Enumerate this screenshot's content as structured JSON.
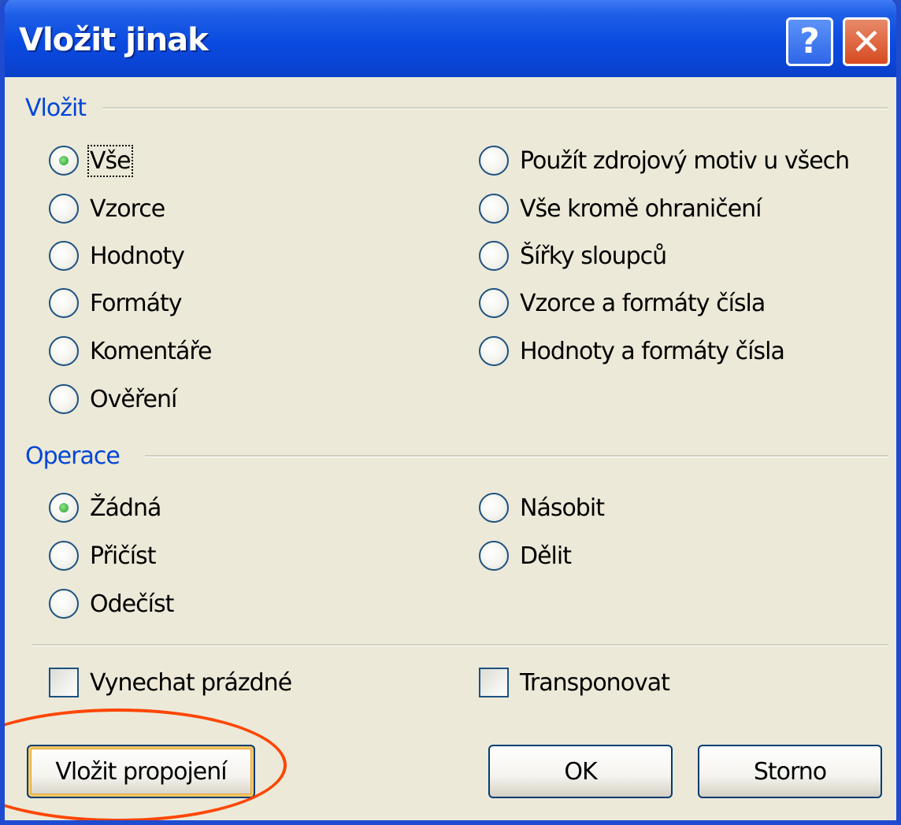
{
  "window": {
    "title": "Vložit jinak",
    "help_button_label": "?",
    "close_button_label": "✕"
  },
  "paste_group": {
    "label": "Vložit",
    "options_left": [
      {
        "label": "Vše",
        "checked": true
      },
      {
        "label": "Vzorce",
        "checked": false
      },
      {
        "label": "Hodnoty",
        "checked": false
      },
      {
        "label": "Formáty",
        "checked": false
      },
      {
        "label": "Komentáře",
        "checked": false
      },
      {
        "label": "Ověření",
        "checked": false
      }
    ],
    "options_right": [
      {
        "label": "Použít zdrojový motiv u všech",
        "checked": false
      },
      {
        "label": "Vše kromě ohraničení",
        "checked": false
      },
      {
        "label": "Šířky sloupců",
        "checked": false
      },
      {
        "label": "Vzorce a formáty čísla",
        "checked": false
      },
      {
        "label": "Hodnoty a formáty čísla",
        "checked": false
      }
    ]
  },
  "operation_group": {
    "label": "Operace",
    "options_left": [
      {
        "label": "Žádná",
        "checked": true
      },
      {
        "label": "Přičíst",
        "checked": false
      },
      {
        "label": "Odečíst",
        "checked": false
      }
    ],
    "options_right": [
      {
        "label": "Násobit",
        "checked": false
      },
      {
        "label": "Dělit",
        "checked": false
      }
    ]
  },
  "checkboxes": {
    "skip_blanks": {
      "label": "Vynechat prázdné",
      "checked": false
    },
    "transpose": {
      "label": "Transponovat",
      "checked": false
    }
  },
  "buttons": {
    "paste_link": "Vložit propojení",
    "ok": "OK",
    "cancel": "Storno"
  },
  "colors": {
    "title_bar": "#0a4ae0",
    "group_label": "#0046d5",
    "highlight": "#ff4500",
    "dialog_background": "#ece9d8"
  }
}
